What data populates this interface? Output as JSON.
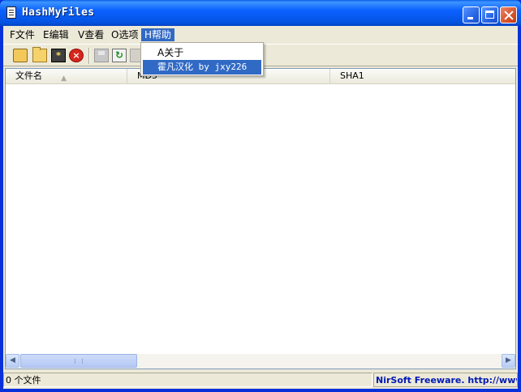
{
  "window": {
    "title": "HashMyFiles"
  },
  "menu": [
    {
      "label": "F文件"
    },
    {
      "label": "E编辑"
    },
    {
      "label": "V查看"
    },
    {
      "label": "O选项"
    },
    {
      "label": "H帮助",
      "active": true
    }
  ],
  "help_menu": {
    "items": [
      {
        "label": "A关于"
      },
      {
        "label": "霍凡汉化 by jxy226",
        "highlighted": true
      }
    ]
  },
  "toolbar": {
    "icons": [
      "open-files-icon",
      "open-folder-icon",
      "wildcard-icon",
      "stop-icon",
      "save-icon",
      "refresh-icon",
      "copy-icon"
    ]
  },
  "list": {
    "columns": [
      {
        "label": "文件名",
        "sorted": "ascending"
      },
      {
        "label": "MD5"
      },
      {
        "label": "SHA1"
      }
    ],
    "rows": []
  },
  "status": {
    "count_text": "0 个文件",
    "credit_text": "NirSoft Freeware.  http://www.n"
  },
  "colors": {
    "titlebar": "#0b61ff",
    "selection": "#316ac5",
    "credit_text": "#0019b4"
  }
}
